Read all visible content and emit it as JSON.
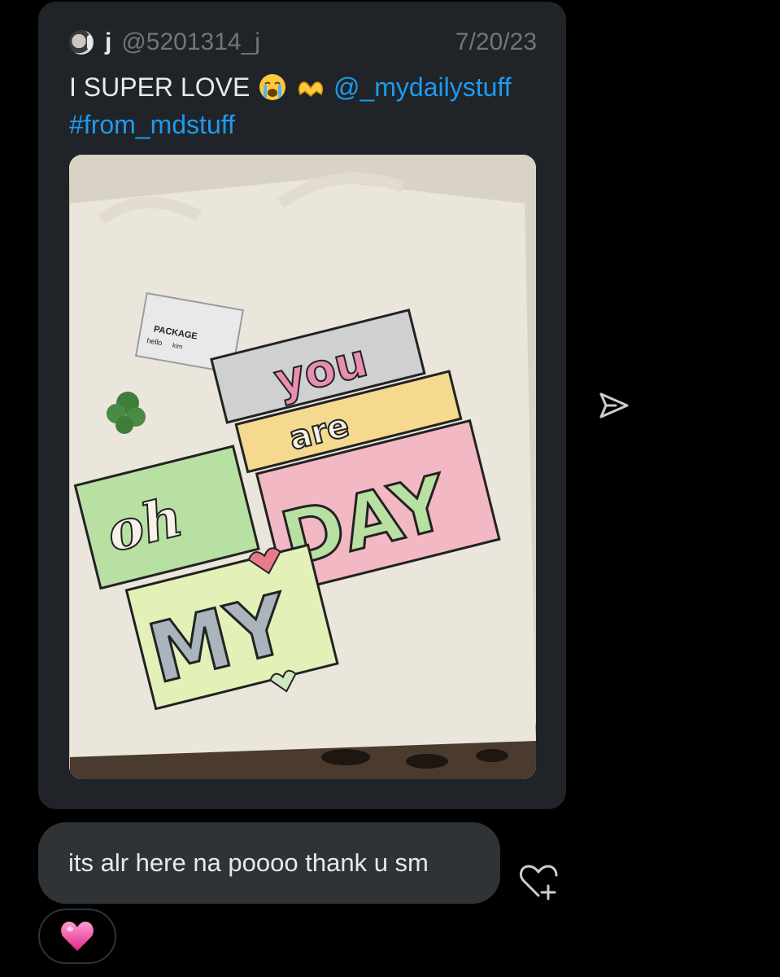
{
  "tweet": {
    "display_name": "j",
    "handle": "@5201314_j",
    "date": "7/20/23",
    "text_before": "I SUPER LOVE",
    "emojis": [
      "loudly-crying-face",
      "heart-hands"
    ],
    "mention": "@_mydailystuff",
    "hashtag": "#from_mdstuff",
    "image": {
      "subject": "tote-bag",
      "print_words": [
        "you",
        "are",
        "oh",
        "MY",
        "DAY"
      ],
      "tag_title": "PACKAGE",
      "tag_greeting": "hello",
      "tag_name": "kim"
    }
  },
  "message": {
    "text": "its alr here na poooo thank u sm",
    "reaction_emoji": "pink-heart"
  },
  "icons": {
    "send": "send-icon",
    "add_reaction": "heart-plus-icon"
  },
  "colors": {
    "background": "#000000",
    "card": "#202327",
    "bubble": "#2f3336",
    "link": "#1d9bf0",
    "muted": "#71767b",
    "text": "#e7e9ea"
  }
}
